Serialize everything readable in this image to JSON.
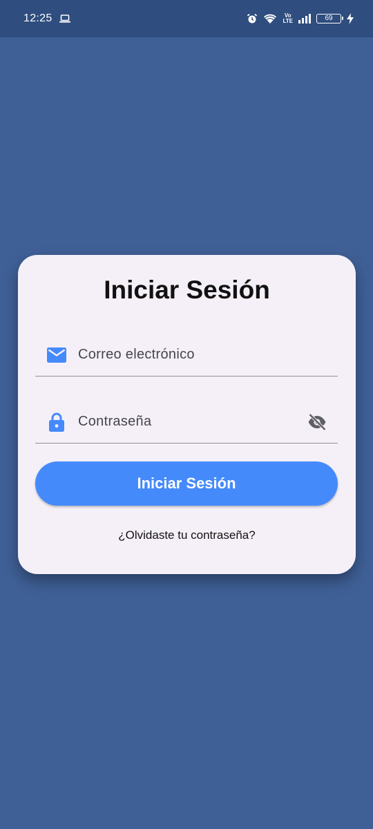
{
  "status_bar": {
    "time": "12:25",
    "battery_level": "69",
    "volte_top": "Vo",
    "volte_bottom": "LTE",
    "icons": [
      "laptop-icon",
      "alarm-icon",
      "wifi-icon",
      "volte-icon",
      "signal-icon",
      "battery-icon",
      "charging-icon"
    ]
  },
  "login": {
    "title": "Iniciar Sesión",
    "email_placeholder": "Correo electrónico",
    "password_placeholder": "Contraseña",
    "submit_label": "Iniciar Sesión",
    "forgot_password": "¿Olvidaste tu contraseña?",
    "icons": {
      "email": "email-icon",
      "password": "lock-icon",
      "visibility": "visibility-off-icon"
    }
  },
  "colors": {
    "background": "#3F6097",
    "status_bar": "#2F4D7E",
    "card": "#F5F0F8",
    "accent": "#458AFB",
    "icon_gray": "#5E5E64"
  }
}
